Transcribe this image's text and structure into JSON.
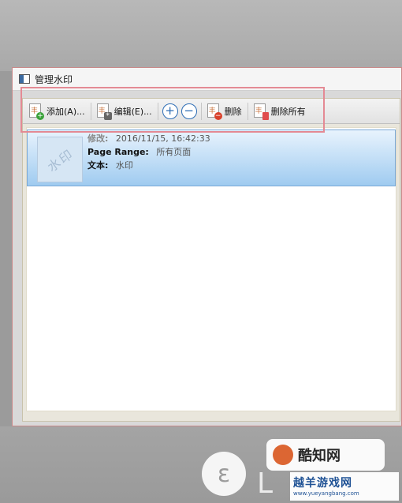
{
  "window": {
    "title": "管理水印"
  },
  "toolbar": {
    "add_label": "添加(A)...",
    "edit_label": "编辑(E)...",
    "plus": "+",
    "minus": "−",
    "delete_label": "删除",
    "delete_all_label": "删除所有"
  },
  "watermark_item": {
    "thumb_text": "水印",
    "modified_label": "修改:",
    "modified_value": "2016/11/15, 16:42:33",
    "page_range_label": "Page Range:",
    "page_range_value": "所有页面",
    "text_label": "文本:",
    "text_value": "水印"
  },
  "brand": {
    "logo_text": "酷知网",
    "site_name": "越羊游戏网",
    "site_url": "www.yueyangbang.com"
  },
  "icons": [
    "window-icon",
    "add-watermark-icon",
    "edit-watermark-icon",
    "zoom-in-icon",
    "zoom-out-icon",
    "delete-icon",
    "delete-all-icon"
  ],
  "colors": {
    "selection": "#9fcbf0",
    "highlight_box": "#e48a94",
    "accent_blue": "#2d6db5"
  }
}
